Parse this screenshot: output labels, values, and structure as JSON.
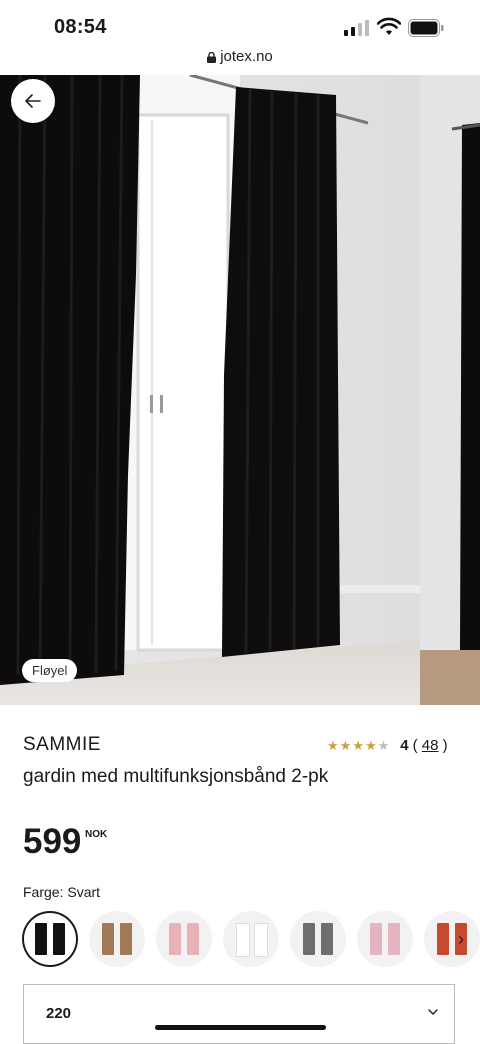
{
  "status_bar": {
    "time": "08:54"
  },
  "browser": {
    "domain": "jotex.no"
  },
  "gallery": {
    "tag": "Fløyel"
  },
  "product": {
    "brand": "SAMMIE",
    "name": "gardin med multifunksjonsbånd 2-pk",
    "price": "599",
    "currency": "NOK",
    "rating": {
      "stars": 4,
      "max": 5,
      "value": "4",
      "count_open": "(",
      "count": "48",
      "count_close": ")"
    },
    "color_label": "Farge: Svart",
    "swatches": [
      {
        "name": "Svart",
        "color": "#111111",
        "selected": true
      },
      {
        "name": "brown",
        "color": "#a07b55",
        "selected": false
      },
      {
        "name": "pink",
        "color": "#e8b2b6",
        "selected": false
      },
      {
        "name": "white",
        "color": "#ffffff",
        "selected": false
      },
      {
        "name": "grey",
        "color": "#6e6e6e",
        "selected": false
      },
      {
        "name": "light-pink",
        "color": "#e6b3c0",
        "selected": false
      },
      {
        "name": "rust",
        "color": "#c74a30",
        "selected": false
      }
    ],
    "size_value": "220"
  }
}
